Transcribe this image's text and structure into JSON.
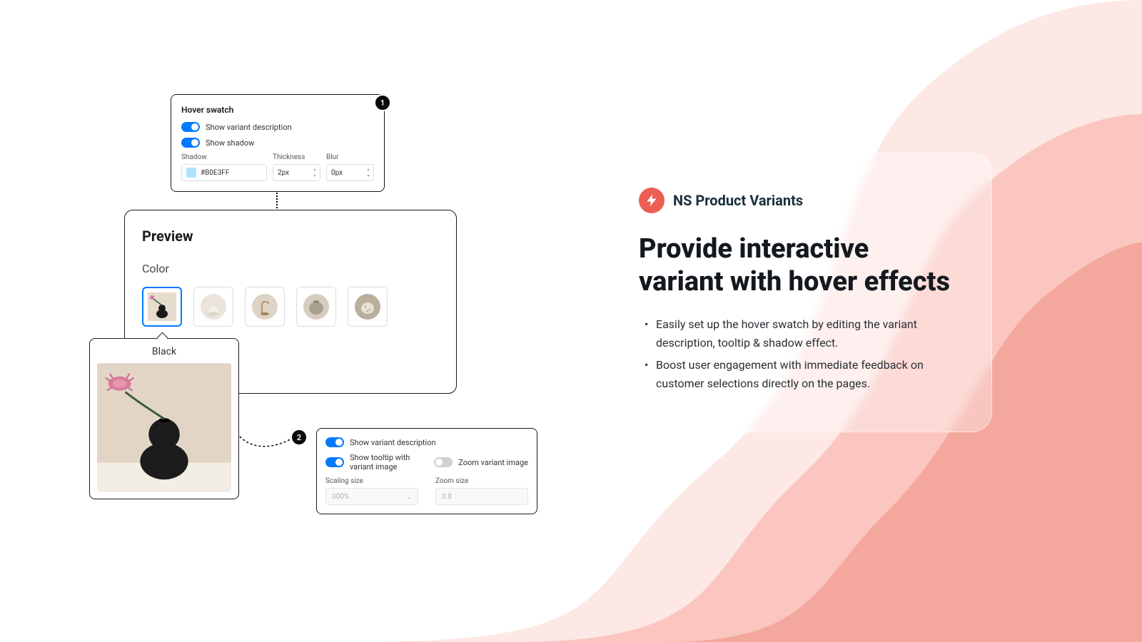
{
  "panel1": {
    "title": "Hover swatch",
    "toggle_desc": "Show variant description",
    "toggle_shadow": "Show shadow",
    "shadow_label": "Shadow",
    "shadow_value": "#B0E3FF",
    "thickness_label": "Thickness",
    "thickness_value": "2px",
    "blur_label": "Blur",
    "blur_value": "0px"
  },
  "badge1": "1",
  "badge2": "2",
  "preview": {
    "title": "Preview",
    "option_label": "Color"
  },
  "tooltip": {
    "label": "Black"
  },
  "panel2": {
    "toggle_desc": "Show variant description",
    "toggle_tooltip": "Show tooltip with variant image",
    "toggle_zoom": "Zoom variant image",
    "scaling_label": "Scaling size",
    "scaling_value": "300%",
    "zoom_label": "Zoom size",
    "zoom_value": "0.8"
  },
  "info": {
    "brand": "NS Product Variants",
    "title": "Provide interactive variant with hover effects",
    "bullet1": "Easily set up the hover swatch by editing the variant description, tooltip & shadow effect.",
    "bullet2": "Boost user engagement with immediate feedback on customer selections directly on the pages."
  }
}
